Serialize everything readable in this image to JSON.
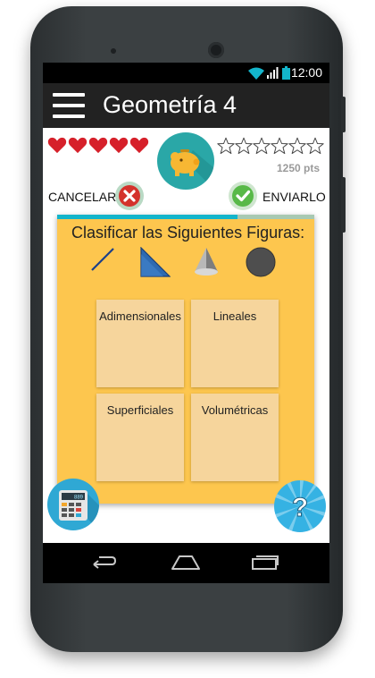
{
  "status_bar": {
    "time": "12:00",
    "icons": [
      "wifi-icon",
      "signal-icon",
      "battery-icon"
    ]
  },
  "app_bar": {
    "title": "Geometría 4",
    "menu_icon": "hamburger-menu-icon"
  },
  "game": {
    "lives": 5,
    "stars_total": 6,
    "stars_earned": 0,
    "points": "1250 pts",
    "progress": 0.7
  },
  "actions": {
    "cancel_label": "CANCELAR",
    "send_label": "ENVIARLO"
  },
  "exercise": {
    "title": "Clasificar las Siguientes Figuras:",
    "figures": [
      "line-segment-icon",
      "right-triangle-icon",
      "cone-icon",
      "circle-icon"
    ],
    "categories": [
      {
        "label": "Adimensionales"
      },
      {
        "label": "Lineales"
      },
      {
        "label": "Superficiales"
      },
      {
        "label": "Volumétricas"
      }
    ]
  },
  "calculator": {
    "display": "889"
  },
  "colors": {
    "panel": "#fdc64e",
    "progress": "#13b5cb",
    "heart": "#d6202a",
    "piggy_bg": "#2aa7a7",
    "help_bg": "#35b2e3"
  }
}
